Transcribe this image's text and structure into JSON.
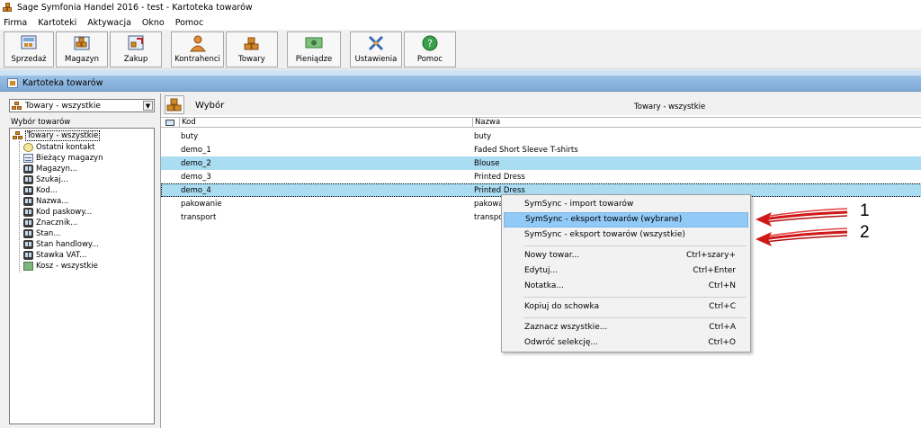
{
  "window": {
    "title": "Sage Symfonia Handel 2016 - test - Kartoteka towarów"
  },
  "menu": [
    "Firma",
    "Kartoteki",
    "Aktywacja",
    "Okno",
    "Pomoc"
  ],
  "toolbar": {
    "buttons": [
      {
        "label": "Sprzedaż",
        "icon": "sales-icon"
      },
      {
        "label": "Magazyn",
        "icon": "warehouse-icon"
      },
      {
        "label": "Zakup",
        "icon": "purchase-icon"
      },
      {
        "label": "Kontrahenci",
        "icon": "contractors-icon"
      },
      {
        "label": "Towary",
        "icon": "products-icon"
      },
      {
        "label": "Pieniądze",
        "icon": "money-icon"
      },
      {
        "label": "Ustawienia",
        "icon": "settings-icon"
      },
      {
        "label": "Pomoc",
        "icon": "help-icon"
      }
    ]
  },
  "document": {
    "title": "Kartoteka towarów"
  },
  "left": {
    "select_value": "Towary - wszystkie",
    "tree_label": "Wybór towarów",
    "tree": {
      "root": "Towary - wszystkie",
      "items": [
        {
          "label": "Ostatni kontakt",
          "icon": "clock-icon"
        },
        {
          "label": "Bieżący magazyn",
          "icon": "grid-icon"
        },
        {
          "label": "Magazyn...",
          "icon": "binoculars-icon"
        },
        {
          "label": "Szukaj...",
          "icon": "binoculars-icon"
        },
        {
          "label": "Kod...",
          "icon": "binoculars-icon"
        },
        {
          "label": "Nazwa...",
          "icon": "binoculars-icon"
        },
        {
          "label": "Kod paskowy...",
          "icon": "binoculars-icon"
        },
        {
          "label": "Znacznik...",
          "icon": "binoculars-icon"
        },
        {
          "label": "Stan...",
          "icon": "binoculars-icon"
        },
        {
          "label": "Stan handlowy...",
          "icon": "binoculars-icon"
        },
        {
          "label": "Stawka VAT...",
          "icon": "binoculars-icon"
        },
        {
          "label": "Kosz - wszystkie",
          "icon": "trash-icon"
        }
      ]
    }
  },
  "right": {
    "header_label": "Wybór",
    "filter_label": "Towary - wszystkie",
    "columns": [
      "Kod",
      "Nazwa"
    ],
    "rows": [
      {
        "kod": "buty",
        "nazwa": "buty",
        "selected": false
      },
      {
        "kod": "demo_1",
        "nazwa": "Faded Short Sleeve T-shirts",
        "selected": false
      },
      {
        "kod": "demo_2",
        "nazwa": "Blouse",
        "selected": true
      },
      {
        "kod": "demo_3",
        "nazwa": "Printed Dress",
        "selected": false
      },
      {
        "kod": "demo_4",
        "nazwa": "Printed Dress",
        "selected": true
      },
      {
        "kod": "pakowanie",
        "nazwa": "pakowa",
        "selected": false
      },
      {
        "kod": "transport",
        "nazwa": "transpor",
        "selected": false
      }
    ]
  },
  "context_menu": {
    "items": [
      {
        "label": "SymSync - import towarów",
        "shortcut": ""
      },
      {
        "label": "SymSync - eksport towarów (wybrane)",
        "shortcut": "",
        "highlighted": true
      },
      {
        "label": "SymSync - eksport towarów (wszystkie)",
        "shortcut": ""
      },
      {
        "label": "Nowy towar...",
        "shortcut": "Ctrl+szary+"
      },
      {
        "label": "Edytuj...",
        "shortcut": "Ctrl+Enter"
      },
      {
        "label": "Notatka...",
        "shortcut": "Ctrl+N"
      },
      {
        "label": "Kopiuj do schowka",
        "shortcut": "Ctrl+C"
      },
      {
        "label": "Zaznacz wszystkie...",
        "shortcut": "Ctrl+A"
      },
      {
        "label": "Odwróć selekcję...",
        "shortcut": "Ctrl+O"
      }
    ]
  },
  "annotations": {
    "num1": "1",
    "num2": "2",
    "arrow_color": "#d01818"
  },
  "colors": {
    "selection": "#aadcf2",
    "menu_highlight": "#91c9f7",
    "doc_title_bar": "#8fb6de"
  }
}
